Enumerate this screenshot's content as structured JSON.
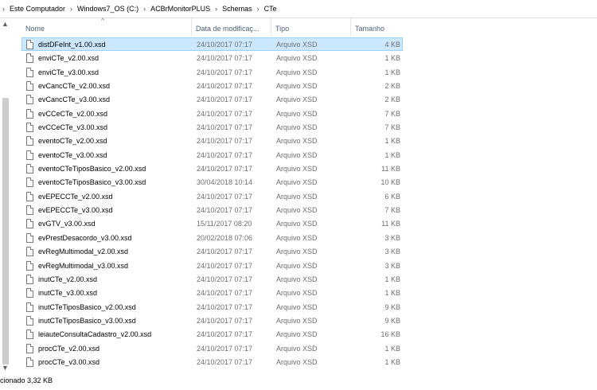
{
  "breadcrumb": {
    "lead_sep": "›",
    "segments": [
      "Este Computador",
      "Windows7_OS (C:)",
      "ACBrMonitorPLUS",
      "Schemas",
      "CTe"
    ],
    "separator": "›"
  },
  "columns": {
    "name": "Nome",
    "date": "Data de modificaç...",
    "type": "Tipo",
    "size": "Tamanho",
    "sort_indicator": "^"
  },
  "files": [
    {
      "name": "distDFeInt_v1.00.xsd",
      "date": "24/10/2017 07:17",
      "type": "Arquivo XSD",
      "size": "4 KB",
      "selected": true
    },
    {
      "name": "enviCTe_v2.00.xsd",
      "date": "24/10/2017 07:17",
      "type": "Arquivo XSD",
      "size": "1 KB"
    },
    {
      "name": "enviCTe_v3.00.xsd",
      "date": "24/10/2017 07:17",
      "type": "Arquivo XSD",
      "size": "1 KB"
    },
    {
      "name": "evCancCTe_v2.00.xsd",
      "date": "24/10/2017 07:17",
      "type": "Arquivo XSD",
      "size": "2 KB"
    },
    {
      "name": "evCancCTe_v3.00.xsd",
      "date": "24/10/2017 07:17",
      "type": "Arquivo XSD",
      "size": "2 KB"
    },
    {
      "name": "evCCeCTe_v2.00.xsd",
      "date": "24/10/2017 07:17",
      "type": "Arquivo XSD",
      "size": "7 KB"
    },
    {
      "name": "evCCeCTe_v3.00.xsd",
      "date": "24/10/2017 07:17",
      "type": "Arquivo XSD",
      "size": "7 KB"
    },
    {
      "name": "eventoCTe_v2.00.xsd",
      "date": "24/10/2017 07:17",
      "type": "Arquivo XSD",
      "size": "1 KB"
    },
    {
      "name": "eventoCTe_v3.00.xsd",
      "date": "24/10/2017 07:17",
      "type": "Arquivo XSD",
      "size": "1 KB"
    },
    {
      "name": "eventoCTeTiposBasico_v2.00.xsd",
      "date": "24/10/2017 07:17",
      "type": "Arquivo XSD",
      "size": "11 KB"
    },
    {
      "name": "eventoCTeTiposBasico_v3.00.xsd",
      "date": "30/04/2018 10:14",
      "type": "Arquivo XSD",
      "size": "10 KB"
    },
    {
      "name": "evEPECCTe_v2.00.xsd",
      "date": "24/10/2017 07:17",
      "type": "Arquivo XSD",
      "size": "6 KB"
    },
    {
      "name": "evEPECCTe_v3.00.xsd",
      "date": "24/10/2017 07:17",
      "type": "Arquivo XSD",
      "size": "7 KB"
    },
    {
      "name": "evGTV_v3.00.xsd",
      "date": "15/11/2017 08:20",
      "type": "Arquivo XSD",
      "size": "11 KB"
    },
    {
      "name": "evPrestDesacordo_v3.00.xsd",
      "date": "20/02/2018 07:06",
      "type": "Arquivo XSD",
      "size": "3 KB"
    },
    {
      "name": "evRegMultimodal_v2.00.xsd",
      "date": "24/10/2017 07:17",
      "type": "Arquivo XSD",
      "size": "3 KB"
    },
    {
      "name": "evRegMultimodal_v3.00.xsd",
      "date": "24/10/2017 07:17",
      "type": "Arquivo XSD",
      "size": "3 KB"
    },
    {
      "name": "inutCTe_v2.00.xsd",
      "date": "24/10/2017 07:17",
      "type": "Arquivo XSD",
      "size": "1 KB"
    },
    {
      "name": "inutCTe_v3.00.xsd",
      "date": "24/10/2017 07:17",
      "type": "Arquivo XSD",
      "size": "1 KB"
    },
    {
      "name": "inutCTeTiposBasico_v2.00.xsd",
      "date": "24/10/2017 07:17",
      "type": "Arquivo XSD",
      "size": "9 KB"
    },
    {
      "name": "inutCTeTiposBasico_v3.00.xsd",
      "date": "24/10/2017 07:17",
      "type": "Arquivo XSD",
      "size": "9 KB"
    },
    {
      "name": "leiauteConsultaCadastro_v2.00.xsd",
      "date": "24/10/2017 07:17",
      "type": "Arquivo XSD",
      "size": "16 KB"
    },
    {
      "name": "procCTe_v2.00.xsd",
      "date": "24/10/2017 07:17",
      "type": "Arquivo XSD",
      "size": "1 KB"
    },
    {
      "name": "procCTe_v3.00.xsd",
      "date": "24/10/2017 07:17",
      "type": "Arquivo XSD",
      "size": "1 KB"
    }
  ],
  "status": {
    "text": "cionado  3,32 KB"
  },
  "icons": {
    "file": "xsd-file-icon",
    "scroll_up": "scroll-up-arrow-icon",
    "scroll_down": "scroll-down-arrow-icon"
  },
  "colors": {
    "selection_bg": "#cce8ff",
    "selection_border": "#99d1ff",
    "header_text": "#4c607a",
    "secondary_text": "#6d6d6d"
  }
}
